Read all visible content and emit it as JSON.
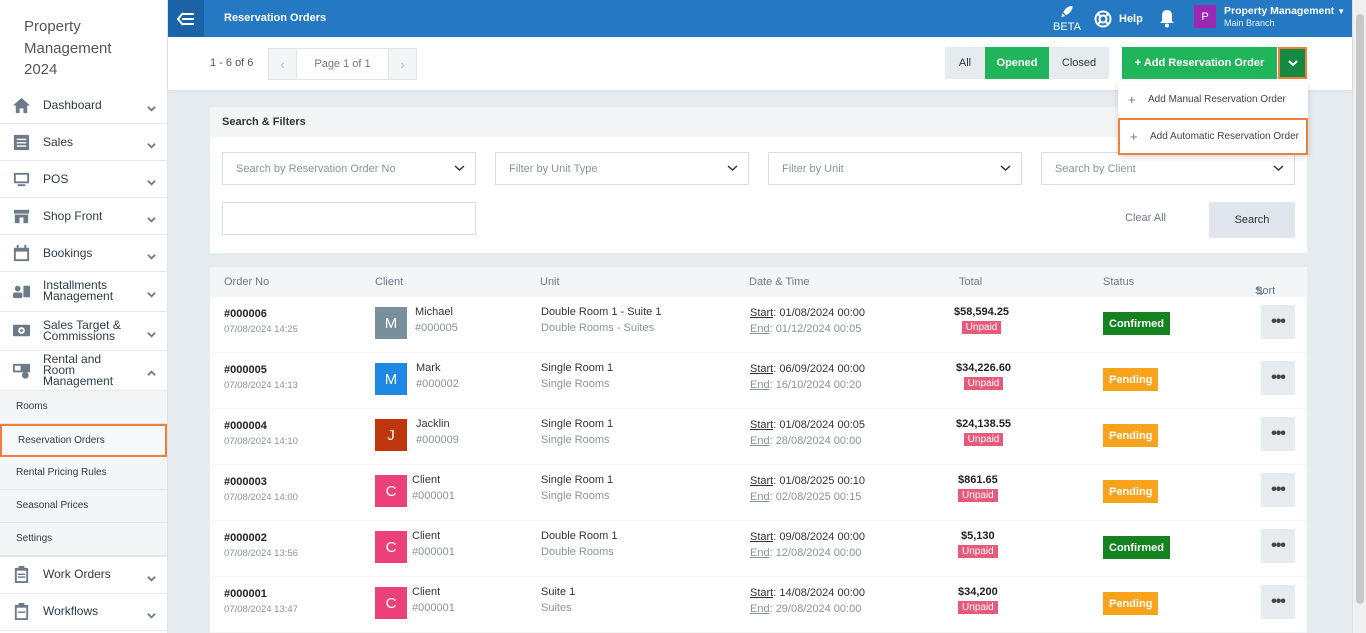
{
  "sidebar": {
    "brand": [
      "Property",
      "Management",
      "2024"
    ],
    "items": [
      {
        "label": "Dashboard",
        "icon": "home-icon"
      },
      {
        "label": "Sales",
        "icon": "list-icon"
      },
      {
        "label": "POS",
        "icon": "monitor-icon"
      },
      {
        "label": "Shop Front",
        "icon": "store-icon"
      },
      {
        "label": "Bookings",
        "icon": "calendar-icon"
      },
      {
        "label": "Installments Management",
        "icon": "installments-icon"
      },
      {
        "label": "Sales Target & Commissions",
        "icon": "target-icon"
      },
      {
        "label": "Rental and Room Management",
        "icon": "rental-icon"
      }
    ],
    "sub_items": [
      "Rooms",
      "Reservation Orders",
      "Rental Pricing Rules",
      "Seasonal Prices",
      "Settings"
    ],
    "bottom_items": [
      {
        "label": "Work Orders",
        "icon": "clipboard-icon"
      },
      {
        "label": "Workflows",
        "icon": "workflow-icon"
      }
    ]
  },
  "topbar": {
    "title": "Reservation Orders",
    "beta": "BETA",
    "help": "Help",
    "user_initial": "P",
    "user_name": "Property Management",
    "user_branch": "Main Branch"
  },
  "toolbar": {
    "count": "1 - 6 of 6",
    "page": "Page 1 of 1",
    "filter_all": "All",
    "filter_opened": "Opened",
    "filter_closed": "Closed",
    "add_label": "+ Add Reservation Order"
  },
  "dropdown": {
    "items": [
      "Add Manual Reservation Order",
      "Add Automatic Reservation Order"
    ]
  },
  "filters": {
    "title": "Search & Filters",
    "order_no": "Search by Reservation Order No",
    "unit_type": "Filter by Unit Type",
    "unit": "Filter by Unit",
    "client": "Search by Client",
    "clear": "Clear All",
    "search": "Search"
  },
  "table": {
    "headers": {
      "order": "Order No",
      "client": "Client",
      "unit": "Unit",
      "date": "Date & Time",
      "total": "Total",
      "status": "Status",
      "sort": "Sort"
    },
    "start_label": "Start",
    "end_label": "End",
    "rows": [
      {
        "no": "#000006",
        "created": "07/08/2024 14:25",
        "initial": "M",
        "avatar_color": "#78909c",
        "client": "Michael",
        "client_no": "#000005",
        "unit": "Double Room 1 - Suite 1",
        "unit_type": "Double Rooms - Suites",
        "start": ": 01/08/2024 00:00",
        "end": ": 01/12/2024 00:05",
        "total": "$58,594.25",
        "payment": "Unpaid",
        "status": "Confirmed"
      },
      {
        "no": "#000005",
        "created": "07/08/2024 14:13",
        "initial": "M",
        "avatar_color": "#1e88e5",
        "client": "Mark",
        "client_no": "#000002",
        "unit": "Single Room 1",
        "unit_type": "Single Rooms",
        "start": ": 06/09/2024 00:00",
        "end": ": 16/10/2024 00:20",
        "total": "$34,226.60",
        "payment": "Unpaid",
        "status": "Pending"
      },
      {
        "no": "#000004",
        "created": "07/08/2024 14:10",
        "initial": "J",
        "avatar_color": "#bf360c",
        "client": "Jacklin",
        "client_no": "#000009",
        "unit": "Single Room 1",
        "unit_type": "Single Rooms",
        "start": ": 01/08/2024 00:05",
        "end": ": 28/08/2024 00:00",
        "total": "$24,138.55",
        "payment": "Unpaid",
        "status": "Pending"
      },
      {
        "no": "#000003",
        "created": "07/08/2024 14:00",
        "initial": "C",
        "avatar_color": "#ec407a",
        "client": "Client",
        "client_no": "#000001",
        "unit": "Single Room 1",
        "unit_type": "Single Rooms",
        "start": ": 01/08/2025 00:10",
        "end": ": 02/08/2025 00:15",
        "total": "$861.65",
        "payment": "Unpaid",
        "status": "Pending"
      },
      {
        "no": "#000002",
        "created": "07/08/2024 13:56",
        "initial": "C",
        "avatar_color": "#ec407a",
        "client": "Client",
        "client_no": "#000001",
        "unit": "Double Room 1",
        "unit_type": "Double Rooms",
        "start": ": 09/08/2024 00:00",
        "end": ": 12/08/2024 00:00",
        "total": "$5,130",
        "payment": "Unpaid",
        "status": "Confirmed"
      },
      {
        "no": "#000001",
        "created": "07/08/2024 13:47",
        "initial": "C",
        "avatar_color": "#ec407a",
        "client": "Client",
        "client_no": "#000001",
        "unit": "Suite 1",
        "unit_type": "Suites",
        "start": ": 14/08/2024 00:00",
        "end": ": 29/08/2024 00:00",
        "total": "$34,200",
        "payment": "Unpaid",
        "status": "Pending"
      }
    ]
  },
  "colors": {
    "primary": "#2579c2",
    "green": "#21b55b",
    "confirmed": "#14821f",
    "pending": "#f7a31c",
    "unpaid": "#e85a7a",
    "highlight": "#ef7f3a"
  }
}
